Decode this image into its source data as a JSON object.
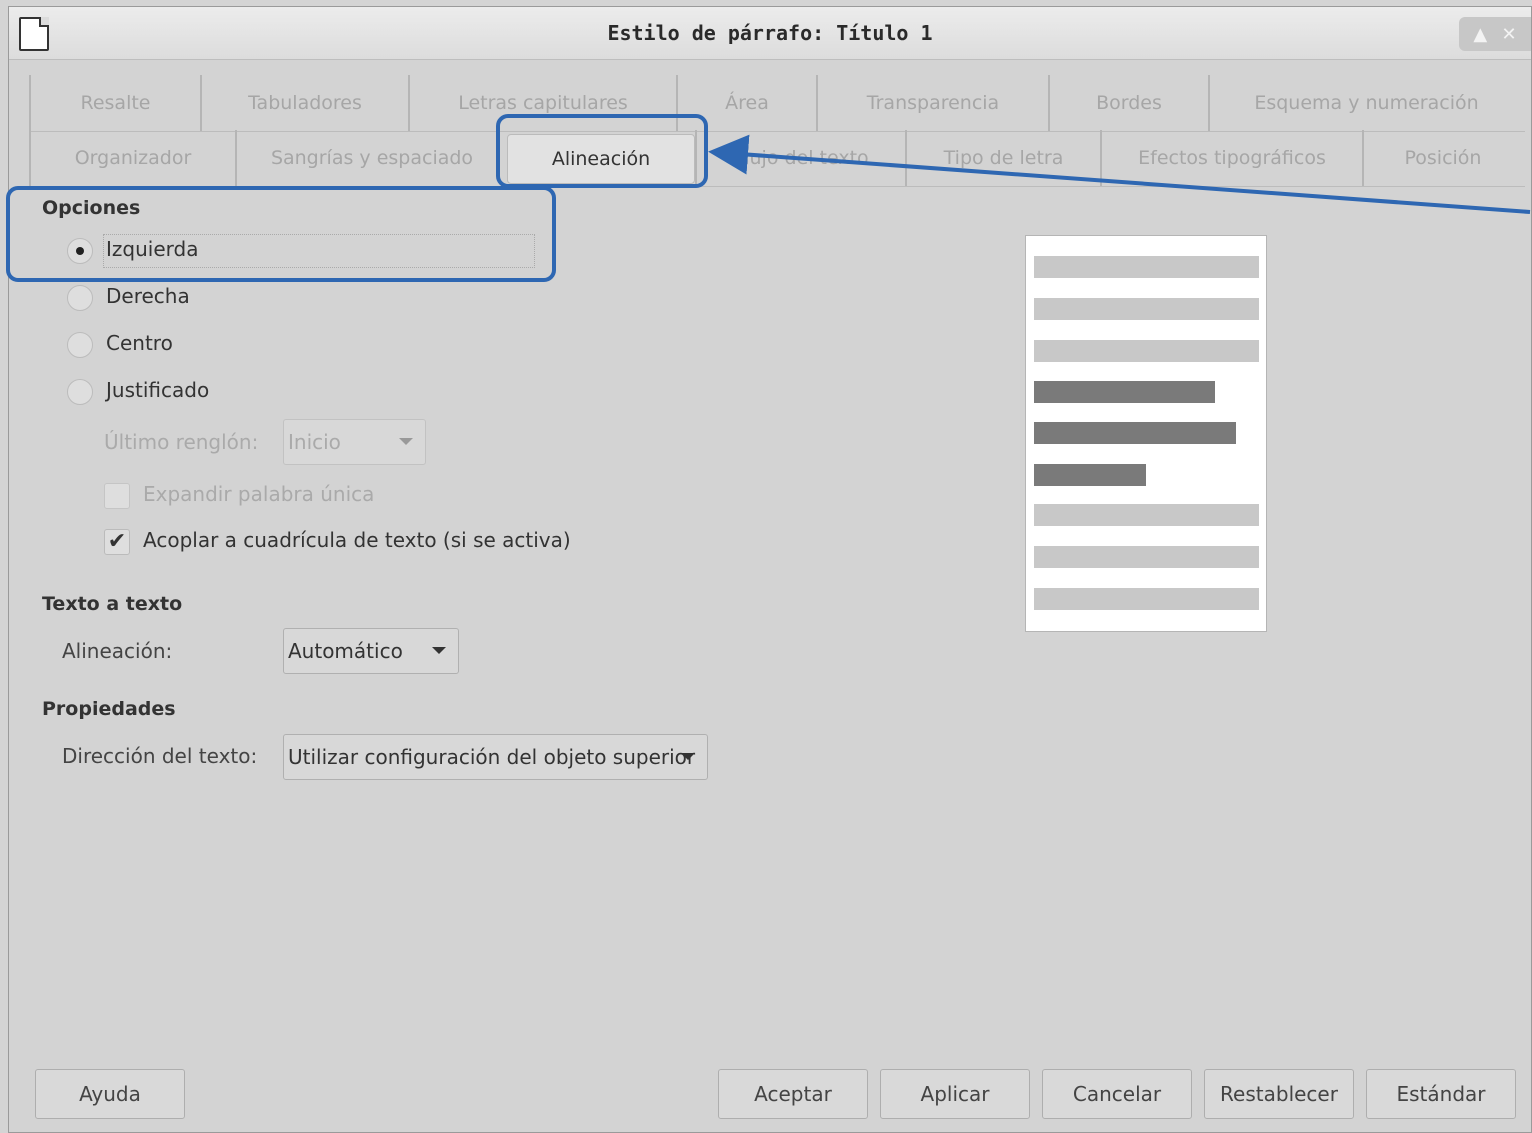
{
  "window": {
    "title": "Estilo de párrafo: Título 1",
    "icon": "document-icon",
    "controls": [
      "maximize-icon",
      "close-icon"
    ]
  },
  "tabs": {
    "row1": [
      "Resalte",
      "Tabuladores",
      "Letras capitulares",
      "Área",
      "Transparencia",
      "Bordes",
      "Esquema y numeración"
    ],
    "row2": [
      "Organizador",
      "Sangrías y espaciado",
      "Alineación",
      "Flujo del texto",
      "Tipo de letra",
      "Efectos tipográficos",
      "Posición"
    ],
    "active": "Alineación"
  },
  "options": {
    "heading": "Opciones",
    "radios": [
      {
        "label": "Izquierda",
        "selected": true
      },
      {
        "label": "Derecha",
        "selected": false
      },
      {
        "label": "Centro",
        "selected": false
      },
      {
        "label": "Justificado",
        "selected": false
      }
    ],
    "last_line_label": "Último renglón:",
    "last_line_value": "Inicio",
    "expand_word_label": "Expandir palabra única",
    "expand_word_checked": false,
    "snap_grid_label": "Acoplar a cuadrícula de texto (si se activa)",
    "snap_grid_checked": true
  },
  "text_to_text": {
    "heading": "Texto a texto",
    "alignment_label": "Alineación:",
    "alignment_value": "Automático"
  },
  "properties": {
    "heading": "Propiedades",
    "direction_label": "Dirección del texto:",
    "direction_value": "Utilizar configuración del objeto superior"
  },
  "buttons": {
    "help": "Ayuda",
    "ok": "Aceptar",
    "apply": "Aplicar",
    "cancel": "Cancelar",
    "reset": "Restablecer",
    "standard": "Estándar"
  },
  "colors": {
    "annotation": "#2e67b2",
    "preview_dark_line": "#7a7a7a",
    "preview_light_line": "#c8c8c8"
  }
}
